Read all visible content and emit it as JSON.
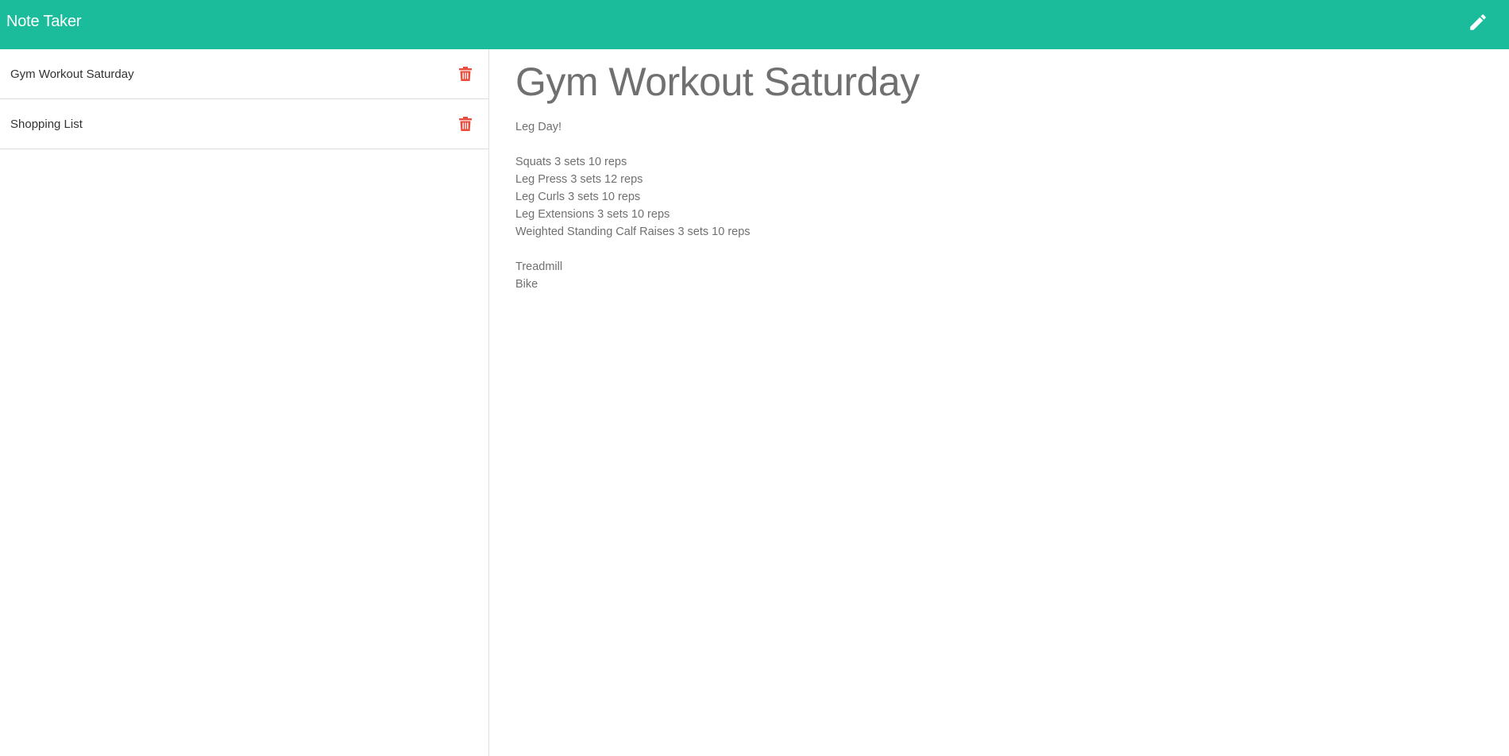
{
  "navbar": {
    "brand": "Note Taker",
    "background": "#1abc9c",
    "icons": [
      "pencil-icon"
    ]
  },
  "sidebar": {
    "items": [
      {
        "title": "Gym Workout Saturday",
        "icon": "trash-icon"
      },
      {
        "title": "Shopping List",
        "icon": "trash-icon"
      }
    ],
    "delete_color": "#e74c3c"
  },
  "note": {
    "title": "Gym Workout Saturday",
    "lines": [
      "Leg Day!",
      "",
      "Squats 3 sets 10 reps",
      "Leg Press 3 sets 12 reps",
      "Leg Curls 3 sets 10 reps",
      "Leg Extensions 3 sets 10 reps",
      "Weighted Standing Calf Raises 3 sets 10 reps",
      "",
      "Treadmill",
      "Bike"
    ]
  }
}
